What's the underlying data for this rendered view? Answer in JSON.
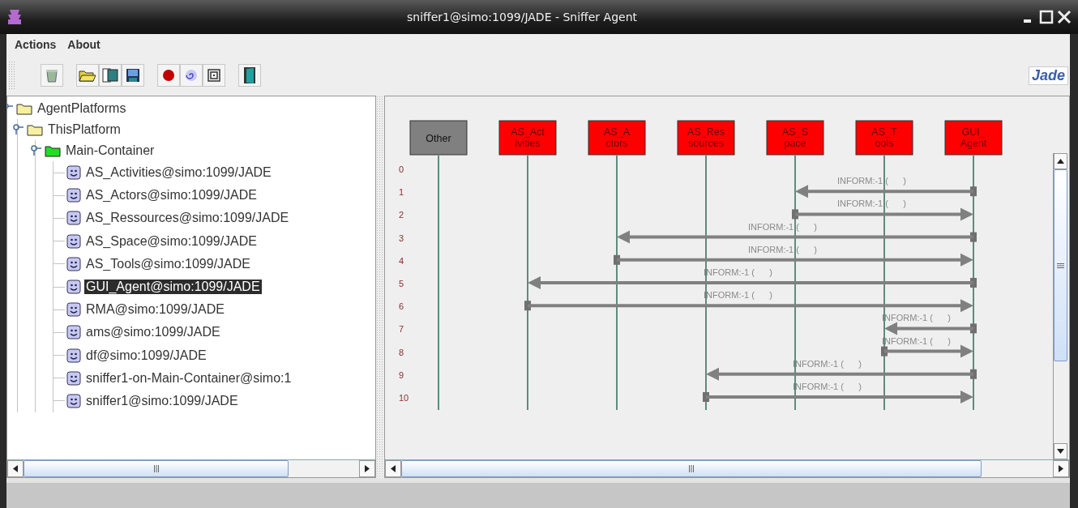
{
  "window": {
    "title": "sniffer1@simo:1099/JADE - Sniffer Agent"
  },
  "menu": [
    "Actions",
    "About"
  ],
  "logo": "Jade",
  "tree": [
    {
      "label": "AgentPlatforms",
      "kind": "platform",
      "expanded": true,
      "selected": false,
      "children": [
        {
          "label": "ThisPlatform",
          "kind": "platform",
          "expanded": true,
          "selected": false,
          "children": [
            {
              "label": "Main-Container",
              "kind": "container",
              "expanded": true,
              "selected": false,
              "children": [
                {
                  "label": "AS_Activities@simo:1099/JADE",
                  "kind": "agent",
                  "selected": false
                },
                {
                  "label": "AS_Actors@simo:1099/JADE",
                  "kind": "agent",
                  "selected": false
                },
                {
                  "label": "AS_Ressources@simo:1099/JADE",
                  "kind": "agent",
                  "selected": false
                },
                {
                  "label": "AS_Space@simo:1099/JADE",
                  "kind": "agent",
                  "selected": false
                },
                {
                  "label": "AS_Tools@simo:1099/JADE",
                  "kind": "agent",
                  "selected": false
                },
                {
                  "label": "GUI_Agent@simo:1099/JADE",
                  "kind": "agent",
                  "selected": true
                },
                {
                  "label": "RMA@simo:1099/JADE",
                  "kind": "agent",
                  "selected": false
                },
                {
                  "label": "ams@simo:1099/JADE",
                  "kind": "agent",
                  "selected": false
                },
                {
                  "label": "df@simo:1099/JADE",
                  "kind": "agent",
                  "selected": false
                },
                {
                  "label": "sniffer1-on-Main-Container@simo:1",
                  "kind": "agent",
                  "selected": false
                },
                {
                  "label": "sniffer1@simo:1099/JADE",
                  "kind": "agent",
                  "selected": false
                }
              ]
            }
          ]
        }
      ]
    }
  ],
  "diagram": {
    "agents": [
      {
        "lines": [
          "Other"
        ],
        "color": "#808080"
      },
      {
        "lines": [
          "AS_Act",
          "ivities"
        ],
        "color": "#ff0000"
      },
      {
        "lines": [
          "AS_A",
          "ctors"
        ],
        "color": "#ff0000"
      },
      {
        "lines": [
          "AS_Res",
          "sources"
        ],
        "color": "#ff0000"
      },
      {
        "lines": [
          "AS_S",
          "pace"
        ],
        "color": "#ff0000"
      },
      {
        "lines": [
          "AS_T",
          "ools"
        ],
        "color": "#ff0000"
      },
      {
        "lines": [
          "GUI_",
          "Agent"
        ],
        "color": "#ff0000"
      }
    ],
    "rows": [
      "0",
      "1",
      "2",
      "3",
      "4",
      "5",
      "6",
      "7",
      "8",
      "9",
      "10"
    ],
    "messages": [
      {
        "label": "INFORM:-1 (      )"
      },
      {
        "label": "INFORM:-1 (      )"
      },
      {
        "label": "INFORM:-1 (      )"
      },
      {
        "label": "INFORM:-1 (      )"
      },
      {
        "label": "INFORM:-1 (      )"
      },
      {
        "label": "INFORM:-1 (      )"
      },
      {
        "label": "INFORM:-1 (      )"
      },
      {
        "label": "INFORM:-1 (      )"
      },
      {
        "label": "INFORM:-1 (      )"
      },
      {
        "label": "INFORM:-1 (      )"
      }
    ]
  }
}
